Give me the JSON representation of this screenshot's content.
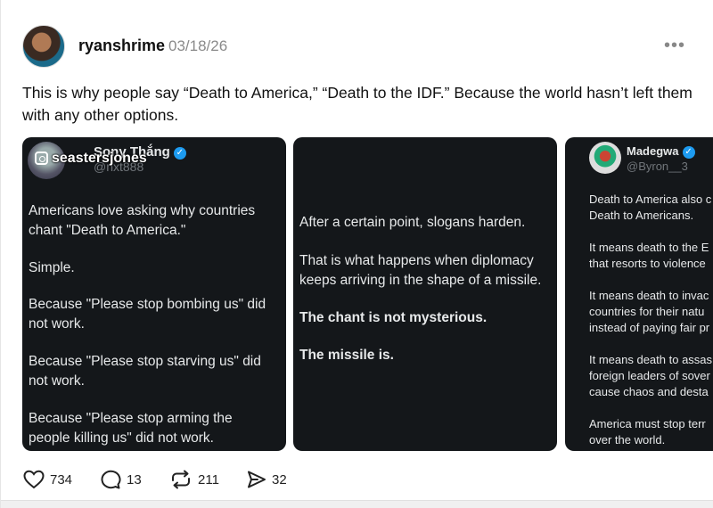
{
  "post": {
    "username": "ryanshrime",
    "timestamp": "03/18/26",
    "more_label": "•••",
    "caption": "This is why people say “Death to America,” “Death to the IDF.” Because the world hasn’t left them with any other options."
  },
  "media": {
    "card1": {
      "watermark": "seastersjones",
      "author_name": "Sony Thắng",
      "author_handle": "@nxt888",
      "paragraphs": [
        "Americans love asking why countries chant \"Death to America.\"",
        "Simple.",
        "Because \"Please stop bombing us\" did not work.",
        "Because \"Please stop starving us\" did not work.",
        "Because \"Please stop arming the people killing us\" did not work."
      ]
    },
    "card2": {
      "paragraphs": [
        "After a certain point, slogans harden.",
        "That is what happens when diplomacy keeps arriving in the shape of a missile.",
        "The chant is not mysterious.",
        "The missile is."
      ]
    },
    "card3": {
      "author_name": "Madegwa",
      "author_handle": "@Byron__3",
      "lines": [
        "Death to America also c",
        "Death to Americans.",
        "It means death to the E",
        "that resorts to violence",
        "It means death to invac",
        "countries for their natu",
        "instead of paying fair pr",
        "It means death to assas",
        "foreign leaders of sover",
        "cause chaos and desta",
        "America must stop terr",
        "over the world."
      ]
    }
  },
  "actions": {
    "likes": "734",
    "replies": "13",
    "reposts": "211",
    "shares": "32"
  },
  "colors": {
    "card_background": "#14171a",
    "verified": "#1d9bf0"
  }
}
